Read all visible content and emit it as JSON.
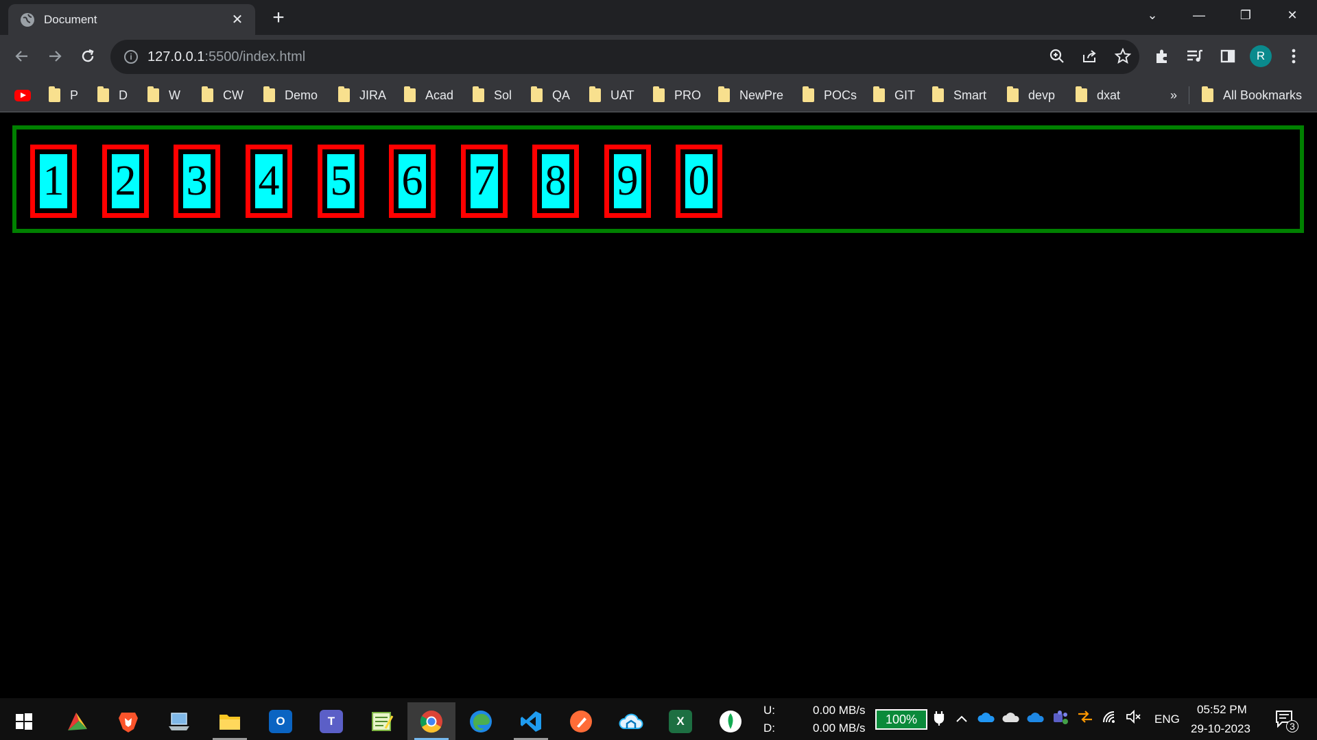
{
  "browser": {
    "tab_title": "Document",
    "tab_close": "✕",
    "new_tab": "+",
    "window_controls": {
      "tab_search": "⌄",
      "minimize": "—",
      "restore": "❐",
      "close": "✕"
    },
    "url_host": "127.0.0.1",
    "url_path": ":5500/index.html",
    "profile_initial": "R"
  },
  "bookmarks": {
    "items": [
      {
        "label": "P"
      },
      {
        "label": "D"
      },
      {
        "label": "W"
      },
      {
        "label": "CW"
      },
      {
        "label": "Demo"
      },
      {
        "label": "JIRA"
      },
      {
        "label": "Acad"
      },
      {
        "label": "Sol"
      },
      {
        "label": "QA"
      },
      {
        "label": "UAT"
      },
      {
        "label": "PRO"
      },
      {
        "label": "NewPre"
      },
      {
        "label": "POCs"
      },
      {
        "label": "GIT"
      },
      {
        "label": "Smart"
      },
      {
        "label": "devp"
      },
      {
        "label": "dxat"
      }
    ],
    "overflow": "»",
    "all_bookmarks": "All Bookmarks"
  },
  "page": {
    "digits": [
      "1",
      "2",
      "3",
      "4",
      "5",
      "6",
      "7",
      "8",
      "9",
      "0"
    ],
    "colors": {
      "container_border": "#008000",
      "box_border": "#ff0000",
      "box_fill": "#00ffff",
      "background": "#000000"
    }
  },
  "taskbar": {
    "apps": [
      {
        "name": "start-icon"
      },
      {
        "name": "app-pie-icon"
      },
      {
        "name": "brave-icon"
      },
      {
        "name": "laptop-icon"
      },
      {
        "name": "file-explorer-icon"
      },
      {
        "name": "outlook-icon"
      },
      {
        "name": "teams-icon"
      },
      {
        "name": "notepad-icon"
      },
      {
        "name": "chrome-icon"
      },
      {
        "name": "edge-icon"
      },
      {
        "name": "vscode-icon"
      },
      {
        "name": "postman-icon"
      },
      {
        "name": "cloud-app-icon"
      },
      {
        "name": "excel-icon"
      },
      {
        "name": "mongodb-icon"
      }
    ],
    "net_upload_label": "U:",
    "net_download_label": "D:",
    "net_upload": "0.00 MB/s",
    "net_download": "0.00 MB/s",
    "battery": "100%",
    "language": "ENG",
    "time": "05:52 PM",
    "date": "29-10-2023",
    "notifications": "3"
  }
}
